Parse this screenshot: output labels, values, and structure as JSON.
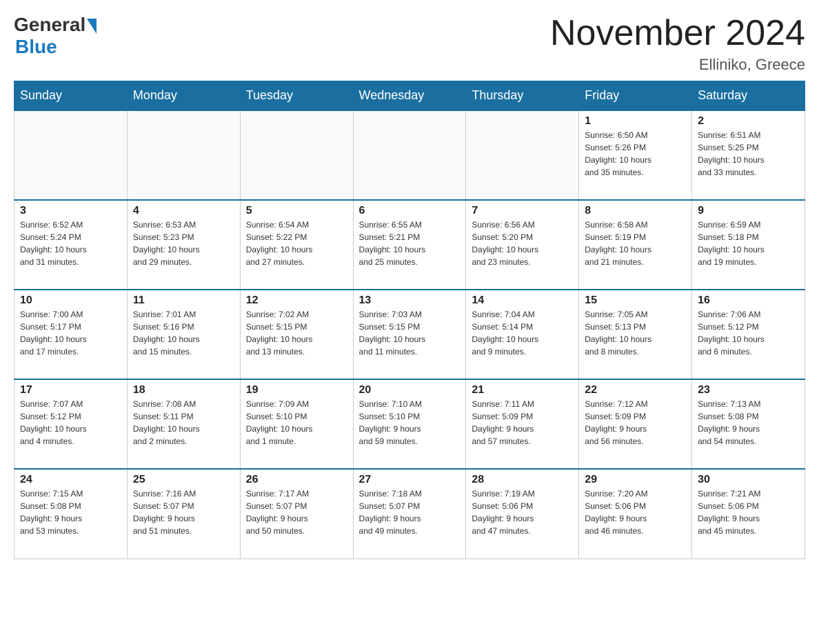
{
  "header": {
    "logo_general": "General",
    "logo_blue": "Blue",
    "month_title": "November 2024",
    "location": "Elliniko, Greece"
  },
  "weekdays": [
    "Sunday",
    "Monday",
    "Tuesday",
    "Wednesday",
    "Thursday",
    "Friday",
    "Saturday"
  ],
  "weeks": [
    [
      {
        "day": "",
        "info": ""
      },
      {
        "day": "",
        "info": ""
      },
      {
        "day": "",
        "info": ""
      },
      {
        "day": "",
        "info": ""
      },
      {
        "day": "",
        "info": ""
      },
      {
        "day": "1",
        "info": "Sunrise: 6:50 AM\nSunset: 5:26 PM\nDaylight: 10 hours\nand 35 minutes."
      },
      {
        "day": "2",
        "info": "Sunrise: 6:51 AM\nSunset: 5:25 PM\nDaylight: 10 hours\nand 33 minutes."
      }
    ],
    [
      {
        "day": "3",
        "info": "Sunrise: 6:52 AM\nSunset: 5:24 PM\nDaylight: 10 hours\nand 31 minutes."
      },
      {
        "day": "4",
        "info": "Sunrise: 6:53 AM\nSunset: 5:23 PM\nDaylight: 10 hours\nand 29 minutes."
      },
      {
        "day": "5",
        "info": "Sunrise: 6:54 AM\nSunset: 5:22 PM\nDaylight: 10 hours\nand 27 minutes."
      },
      {
        "day": "6",
        "info": "Sunrise: 6:55 AM\nSunset: 5:21 PM\nDaylight: 10 hours\nand 25 minutes."
      },
      {
        "day": "7",
        "info": "Sunrise: 6:56 AM\nSunset: 5:20 PM\nDaylight: 10 hours\nand 23 minutes."
      },
      {
        "day": "8",
        "info": "Sunrise: 6:58 AM\nSunset: 5:19 PM\nDaylight: 10 hours\nand 21 minutes."
      },
      {
        "day": "9",
        "info": "Sunrise: 6:59 AM\nSunset: 5:18 PM\nDaylight: 10 hours\nand 19 minutes."
      }
    ],
    [
      {
        "day": "10",
        "info": "Sunrise: 7:00 AM\nSunset: 5:17 PM\nDaylight: 10 hours\nand 17 minutes."
      },
      {
        "day": "11",
        "info": "Sunrise: 7:01 AM\nSunset: 5:16 PM\nDaylight: 10 hours\nand 15 minutes."
      },
      {
        "day": "12",
        "info": "Sunrise: 7:02 AM\nSunset: 5:15 PM\nDaylight: 10 hours\nand 13 minutes."
      },
      {
        "day": "13",
        "info": "Sunrise: 7:03 AM\nSunset: 5:15 PM\nDaylight: 10 hours\nand 11 minutes."
      },
      {
        "day": "14",
        "info": "Sunrise: 7:04 AM\nSunset: 5:14 PM\nDaylight: 10 hours\nand 9 minutes."
      },
      {
        "day": "15",
        "info": "Sunrise: 7:05 AM\nSunset: 5:13 PM\nDaylight: 10 hours\nand 8 minutes."
      },
      {
        "day": "16",
        "info": "Sunrise: 7:06 AM\nSunset: 5:12 PM\nDaylight: 10 hours\nand 6 minutes."
      }
    ],
    [
      {
        "day": "17",
        "info": "Sunrise: 7:07 AM\nSunset: 5:12 PM\nDaylight: 10 hours\nand 4 minutes."
      },
      {
        "day": "18",
        "info": "Sunrise: 7:08 AM\nSunset: 5:11 PM\nDaylight: 10 hours\nand 2 minutes."
      },
      {
        "day": "19",
        "info": "Sunrise: 7:09 AM\nSunset: 5:10 PM\nDaylight: 10 hours\nand 1 minute."
      },
      {
        "day": "20",
        "info": "Sunrise: 7:10 AM\nSunset: 5:10 PM\nDaylight: 9 hours\nand 59 minutes."
      },
      {
        "day": "21",
        "info": "Sunrise: 7:11 AM\nSunset: 5:09 PM\nDaylight: 9 hours\nand 57 minutes."
      },
      {
        "day": "22",
        "info": "Sunrise: 7:12 AM\nSunset: 5:09 PM\nDaylight: 9 hours\nand 56 minutes."
      },
      {
        "day": "23",
        "info": "Sunrise: 7:13 AM\nSunset: 5:08 PM\nDaylight: 9 hours\nand 54 minutes."
      }
    ],
    [
      {
        "day": "24",
        "info": "Sunrise: 7:15 AM\nSunset: 5:08 PM\nDaylight: 9 hours\nand 53 minutes."
      },
      {
        "day": "25",
        "info": "Sunrise: 7:16 AM\nSunset: 5:07 PM\nDaylight: 9 hours\nand 51 minutes."
      },
      {
        "day": "26",
        "info": "Sunrise: 7:17 AM\nSunset: 5:07 PM\nDaylight: 9 hours\nand 50 minutes."
      },
      {
        "day": "27",
        "info": "Sunrise: 7:18 AM\nSunset: 5:07 PM\nDaylight: 9 hours\nand 49 minutes."
      },
      {
        "day": "28",
        "info": "Sunrise: 7:19 AM\nSunset: 5:06 PM\nDaylight: 9 hours\nand 47 minutes."
      },
      {
        "day": "29",
        "info": "Sunrise: 7:20 AM\nSunset: 5:06 PM\nDaylight: 9 hours\nand 46 minutes."
      },
      {
        "day": "30",
        "info": "Sunrise: 7:21 AM\nSunset: 5:06 PM\nDaylight: 9 hours\nand 45 minutes."
      }
    ]
  ]
}
